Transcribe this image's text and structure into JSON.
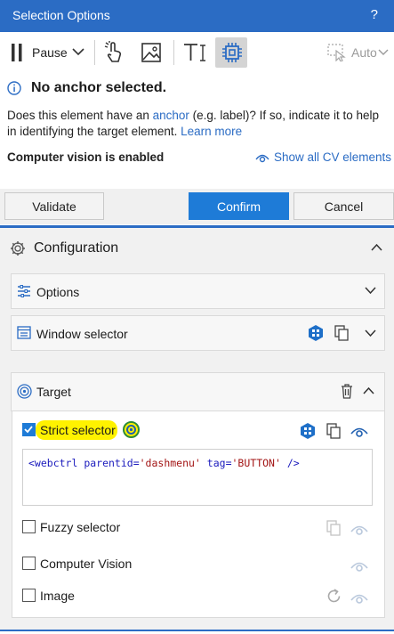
{
  "window": {
    "title": "Selection Options",
    "help": "?"
  },
  "toolbar": {
    "pause_label": "Pause",
    "auto_label": "Auto"
  },
  "message": {
    "title": "No anchor selected.",
    "body_pre": "Does this element have an ",
    "body_link": "anchor",
    "body_post": " (e.g. label)? If so, indicate it to help in identifying the target element. ",
    "learn_more": "Learn more",
    "cv_enabled": "Computer vision is enabled",
    "show_cv": "Show all CV elements"
  },
  "actions": {
    "validate": "Validate",
    "confirm": "Confirm",
    "cancel": "Cancel"
  },
  "configuration": {
    "title": "Configuration",
    "options_label": "Options",
    "window_selector_label": "Window selector",
    "target_label": "Target"
  },
  "target": {
    "strict_selector_label": "Strict selector",
    "strict_checked": true,
    "code": {
      "open": "<webctrl ",
      "attr1": "parentid=",
      "val1": "'dashmenu'",
      "attr2": " tag=",
      "val2": "'BUTTON'",
      "close": " />"
    },
    "fuzzy_selector_label": "Fuzzy selector",
    "computer_vision_label": "Computer Vision",
    "image_label": "Image"
  },
  "colors": {
    "accent": "#2b6cc4",
    "confirm": "#1e7bd7",
    "highlight": "#fff200"
  }
}
